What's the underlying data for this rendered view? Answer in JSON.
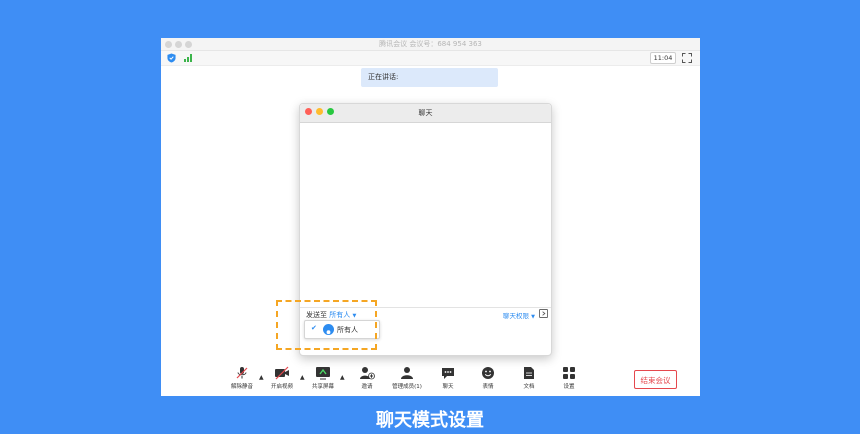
{
  "window": {
    "title": "腾讯会议 会议号：684 954 363",
    "time": "11:04"
  },
  "speaking": "正在讲话:",
  "chat": {
    "title": "聊天",
    "send_to_label": "发送至",
    "send_to_value": "所有人",
    "permission_label": "聊天权限",
    "dropdown_option": "所有人"
  },
  "toolbar": {
    "unmute": "解除静音",
    "start_video": "开启视频",
    "share_screen": "共享屏幕",
    "invite": "邀请",
    "manage_members": "管理成员(1)",
    "chat": "聊天",
    "emoji": "表情",
    "docs": "文档",
    "settings": "设置",
    "end_meeting": "结束会议"
  },
  "caption": "聊天模式设置",
  "colors": {
    "background": "#3f8ef5",
    "accent": "#2d8cf0",
    "highlight_dash": "#f5a623",
    "end_button": "#e5484d"
  }
}
